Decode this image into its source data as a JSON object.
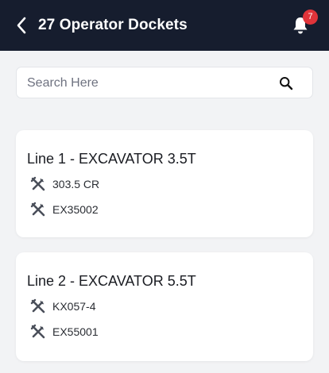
{
  "header": {
    "title": "27 Operator Dockets",
    "notification_count": "7",
    "background_color": "#161d2e",
    "badge_color": "#e0343a"
  },
  "search": {
    "placeholder": "Search Here",
    "value": ""
  },
  "dockets": [
    {
      "title": "Line 1 - EXCAVATOR 3.5T",
      "rows": [
        {
          "icon": "tools-icon",
          "text": "303.5 CR"
        },
        {
          "icon": "tools-icon",
          "text": "EX35002"
        }
      ]
    },
    {
      "title": "Line 2 - EXCAVATOR 5.5T",
      "rows": [
        {
          "icon": "tools-icon",
          "text": "KX057-4"
        },
        {
          "icon": "tools-icon",
          "text": "EX55001"
        }
      ]
    }
  ]
}
